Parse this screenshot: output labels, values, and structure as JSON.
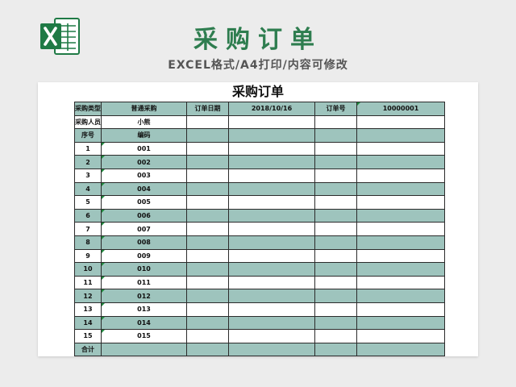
{
  "header": {
    "title": "采购订单",
    "subtitle": "EXCEL格式/A4打印/内容可修改",
    "logo_icon": "excel-icon",
    "brand_color": "#2e7d4f",
    "accent_color": "#9ec4bd"
  },
  "sheet": {
    "title": "采购订单",
    "info": {
      "type_label": "采购类型",
      "type_value": "普通采购",
      "date_label": "订单日期",
      "date_value": "2018/10/16",
      "order_no_label": "订单号",
      "order_no_value": "10000001",
      "buyer_label": "采购人员",
      "buyer_value": "小熊"
    },
    "headers": {
      "seq": "序号",
      "code": "编码"
    },
    "rows": [
      {
        "seq": "1",
        "code": "001"
      },
      {
        "seq": "2",
        "code": "002"
      },
      {
        "seq": "3",
        "code": "003"
      },
      {
        "seq": "4",
        "code": "004"
      },
      {
        "seq": "5",
        "code": "005"
      },
      {
        "seq": "6",
        "code": "006"
      },
      {
        "seq": "7",
        "code": "007"
      },
      {
        "seq": "8",
        "code": "008"
      },
      {
        "seq": "9",
        "code": "009"
      },
      {
        "seq": "10",
        "code": "010"
      },
      {
        "seq": "11",
        "code": "011"
      },
      {
        "seq": "12",
        "code": "012"
      },
      {
        "seq": "13",
        "code": "013"
      },
      {
        "seq": "14",
        "code": "014"
      },
      {
        "seq": "15",
        "code": "015"
      }
    ],
    "total_label": "合计"
  }
}
